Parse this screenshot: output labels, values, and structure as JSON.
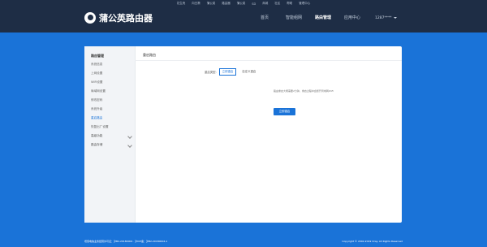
{
  "top_nav": [
    "花生壳",
    "向日葵",
    "蒲公英",
    "路由器",
    "蒲公英",
    "SD",
    "商城",
    "社区",
    "帮助",
    "管理中心"
  ],
  "brand": {
    "name": "蒲公英路由器"
  },
  "main_nav": [
    {
      "label": "首页",
      "active": false
    },
    {
      "label": "智能组网",
      "active": false
    },
    {
      "label": "路由管理",
      "active": true
    },
    {
      "label": "应用中心",
      "active": false
    }
  ],
  "user": {
    "display": "1287****"
  },
  "sidebar": {
    "title": "路由管理",
    "items": [
      {
        "label": "系统信息",
        "active": false
      },
      {
        "label": "上网设置",
        "active": false
      },
      {
        "label": "WiFi设置",
        "active": false
      },
      {
        "label": "局域网设置",
        "active": false
      },
      {
        "label": "修改密码",
        "active": false
      },
      {
        "label": "系统升级",
        "active": false
      },
      {
        "label": "重启路由",
        "active": true
      },
      {
        "label": "恢复出厂设置",
        "active": false
      }
    ],
    "groups": [
      {
        "label": "高级功能"
      },
      {
        "label": "路由存储"
      }
    ]
  },
  "page": {
    "title": "重启路由",
    "restart_type_label": "重启类型:",
    "options": [
      "立即重启",
      "自定义重启"
    ],
    "note": "路由重启大概需要2分钟，重启过程中会断开局域网WiFi",
    "action_label": "立即重启"
  },
  "footer": {
    "left": "增值电信业务经营许可证：沪B2-20180004 · 沪ICP备：沪B2-20180004-1",
    "right": "Copyright © 2002-2019 Oray. All Rights Reserved"
  },
  "colors": {
    "background": "#1a73d8",
    "header": "#1e2d45",
    "accent": "#1a73d8"
  }
}
